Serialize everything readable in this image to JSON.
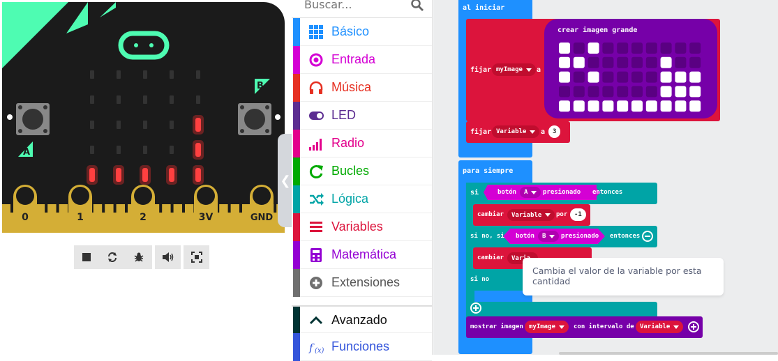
{
  "colors": {
    "board_bg": "#1b1b1b",
    "board_accent": "#4efcb2",
    "gold": "#d4ae36",
    "led_on": "#ff3030",
    "basico": "#1e90ff",
    "entrada": "#d400d4",
    "musica": "#e63022",
    "led": "#5c2d91",
    "radio": "#e3008c",
    "bucles": "#00aa00",
    "logica": "#00a4a6",
    "variables": "#dc143c",
    "matematica": "#9400d3",
    "extensiones": "#6f6f6f",
    "avanzado": "#003333",
    "funciones": "#3455db",
    "blue_block": "#1e90ff",
    "teal_block": "#00a4a6",
    "red_block": "#dc143c",
    "purple_block": "#7600a8",
    "magenta_block": "#d400d4"
  },
  "board": {
    "pins": [
      "0",
      "1",
      "2",
      "3V",
      "GND"
    ],
    "button_a": "A",
    "button_b": "B"
  },
  "simulator_controls": {
    "icons": [
      "stop-icon",
      "restart-icon",
      "debug-icon",
      "sound-icon",
      "fullscreen-icon"
    ]
  },
  "toolbox": {
    "search_placeholder": "Buscar...",
    "categories": [
      {
        "label": "Básico",
        "icon": "grid-icon",
        "color": "#1e90ff"
      },
      {
        "label": "Entrada",
        "icon": "circle-dot-icon",
        "color": "#d400d4"
      },
      {
        "label": "Música",
        "icon": "headphones-icon",
        "color": "#e63022"
      },
      {
        "label": "LED",
        "icon": "toggle-icon",
        "color": "#5c2d91"
      },
      {
        "label": "Radio",
        "icon": "signal-bars-icon",
        "color": "#e3008c"
      },
      {
        "label": "Bucles",
        "icon": "refresh-icon",
        "color": "#00aa00"
      },
      {
        "label": "Lógica",
        "icon": "shuffle-icon",
        "color": "#00a4a6"
      },
      {
        "label": "Variables",
        "icon": "list-icon",
        "color": "#dc143c"
      },
      {
        "label": "Matemática",
        "icon": "calculator-icon",
        "color": "#9400d3"
      },
      {
        "label": "Extensiones",
        "icon": "plus-circle-icon",
        "color": "#6f6f6f"
      },
      {
        "label": "Avanzado",
        "icon": "chevron-up-icon",
        "color": "#003333"
      },
      {
        "label": "Funciones",
        "icon": "function-icon",
        "color": "#3455db"
      }
    ]
  },
  "workspace": {
    "al_iniciar": "al iniciar",
    "fijar1": "fijar",
    "var1": "myImage",
    "a1": "a",
    "crear_imagen": "crear imagen grande",
    "image_rows": [
      "1010000000",
      "1100000100",
      "1010000111",
      "0000000111",
      "1111111111"
    ],
    "fijar2": "fijar",
    "var2": "Variable",
    "a2": "a",
    "num3": "3",
    "para_siempre": "para siempre",
    "si": "si",
    "boton1": "botón",
    "boton1_val": "A",
    "presionado1": "presionado",
    "entonces1": "entonces",
    "cambiar1": "cambiar",
    "cambiar1_var": "Variable",
    "por1": "por",
    "neg1": "-1",
    "sino_si": "si no, si",
    "boton2": "botón",
    "boton2_val": "B",
    "presionado2": "presionado",
    "entonces2": "entonces",
    "cambiar2": "cambiar",
    "cambiar2_var": "Varia",
    "sino": "si no",
    "mostrar": "mostrar imagen",
    "mostrar_var": "myImage",
    "intervalo": "con intervalo de",
    "intervalo_var": "Variable"
  },
  "tooltip": "Cambia el valor de la variable por esta cantidad"
}
